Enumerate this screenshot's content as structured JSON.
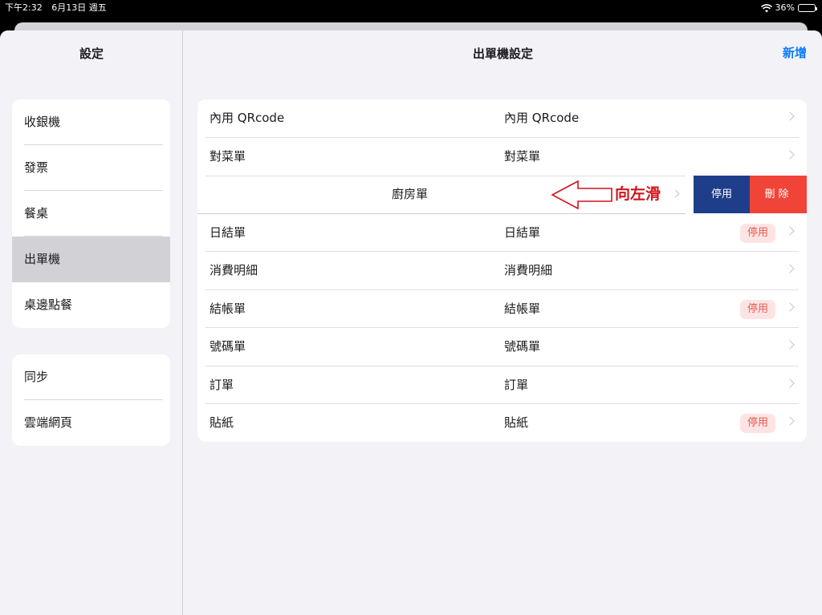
{
  "status": {
    "time": "下午2:32",
    "date": "6月13日 週五",
    "battery": "36%",
    "battery_level": 0.36
  },
  "sidebar": {
    "title": "設定",
    "groups": [
      {
        "items": [
          {
            "label": "收銀機"
          },
          {
            "label": "發票"
          },
          {
            "label": "餐桌"
          },
          {
            "label": "出單機",
            "selected": true
          },
          {
            "label": "桌邊點餐"
          }
        ]
      },
      {
        "items": [
          {
            "label": "同步"
          },
          {
            "label": "雲端網頁"
          }
        ]
      }
    ]
  },
  "main": {
    "title": "出單機設定",
    "add_label": "新增",
    "rows": [
      {
        "name": "內用 QRcode",
        "printer": "內用 QRcode"
      },
      {
        "name": "對菜單",
        "printer": "對菜單"
      },
      {
        "name": "廚房單"
      },
      {
        "name": "日結單",
        "printer": "日結單",
        "badge": "停用"
      },
      {
        "name": "消費明細",
        "printer": "消費明細"
      },
      {
        "name": "結帳單",
        "printer": "結帳單",
        "badge": "停用"
      },
      {
        "name": "號碼單",
        "printer": "號碼單"
      },
      {
        "name": "訂單",
        "printer": "訂單"
      },
      {
        "name": "貼紙",
        "printer": "貼紙",
        "badge": "停用"
      }
    ],
    "swipe_actions": {
      "disable": "停用",
      "delete": "刪除"
    },
    "annotation": "向左滑"
  },
  "colors": {
    "accent": "#0a7aff",
    "disable_action": "#1f3e8a",
    "delete_action": "#f04438",
    "annotation": "#d0141c",
    "badge_text": "#e8594d",
    "badge_bg": "#fde4e4"
  }
}
